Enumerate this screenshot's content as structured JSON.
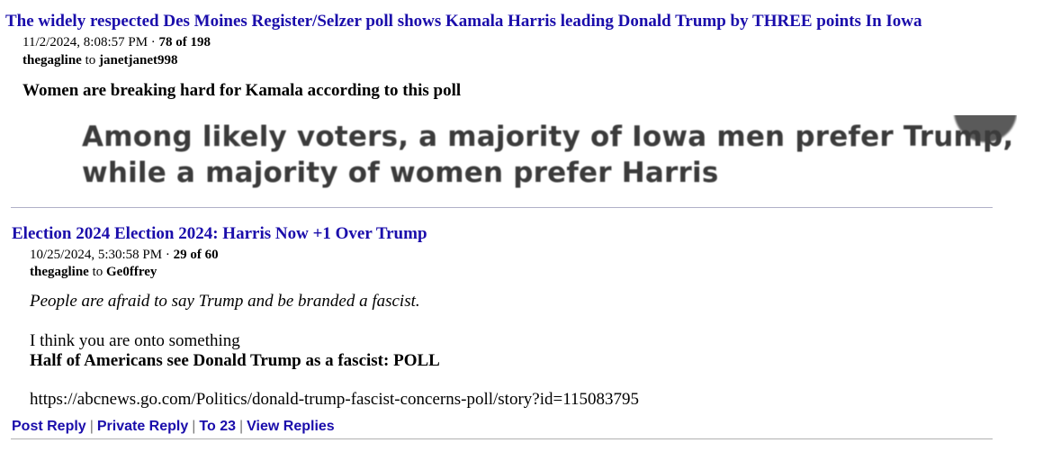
{
  "post1": {
    "title": "The widely respected Des Moines Register/Selzer poll shows Kamala Harris leading Donald Trump by THREE points In Iowa",
    "timestamp": "11/2/2024, 8:08:57 PM",
    "separator": " · ",
    "position": "78 of 198",
    "author": "thegagline",
    "to_word": " to ",
    "recipient": "janetjanet998",
    "body": "Women are breaking hard for Kamala according to this poll",
    "image_line1": "Among likely voters, a majority of Iowa men prefer Trump,",
    "image_line2": "while a majority of women prefer Harris"
  },
  "post2": {
    "title": "Election 2024 Election 2024: Harris Now +1 Over Trump",
    "timestamp": "10/25/2024, 5:30:58 PM",
    "separator": " · ",
    "position": "29 of 60",
    "author": "thegagline",
    "to_word": " to ",
    "recipient": "Ge0ffrey",
    "quote": "People are afraid to say Trump and be branded a fascist.",
    "line1": "I think you are onto something",
    "line2": "Half of Americans see Donald Trump as a fascist: POLL",
    "url": "https://abcnews.go.com/Politics/donald-trump-fascist-concerns-poll/story?id=115083795"
  },
  "actions": {
    "post_reply": "Post Reply",
    "private_reply": "Private Reply",
    "to": "To 23",
    "view_replies": "View Replies",
    "separator": "|"
  },
  "colors": {
    "link": "#1a0dab",
    "image_text": "#3b3b3b"
  }
}
